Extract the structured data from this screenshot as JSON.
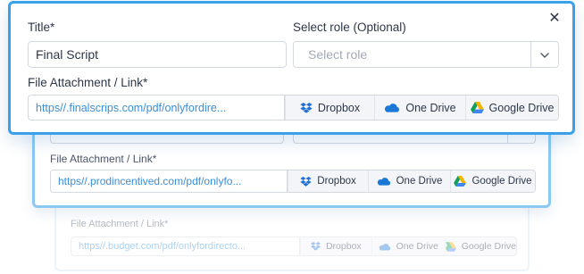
{
  "front": {
    "title_label": "Title*",
    "title_value": "Final Script",
    "role_label": "Select role (Optional)",
    "role_placeholder": "Select role",
    "attachment_label": "File Attachment / Link*",
    "link_value": "https//.finalscrips.com/pdf/onlyfordire...",
    "close_symbol": "✕"
  },
  "middle": {
    "attachment_label": "File Attachment / Link*",
    "link_value": "https//.prodincentived.com/pdf/onlyfo..."
  },
  "back": {
    "attachment_label": "File Attachment / Link*",
    "link_value": "https//.budget.com/pdf/onlyfordirecto..."
  },
  "providers": {
    "dropbox": "Dropbox",
    "onedrive": "One Drive",
    "gdrive": "Google Drive"
  },
  "colors": {
    "accent": "#3aa0ea",
    "link": "#3a8fd8",
    "dropbox": "#1f6fd6",
    "onedrive": "#1a78d6"
  },
  "icons": {
    "close": "close-icon",
    "chevron": "chevron-down-icon",
    "dropbox": "dropbox-icon",
    "onedrive": "onedrive-icon",
    "gdrive": "google-drive-icon"
  }
}
